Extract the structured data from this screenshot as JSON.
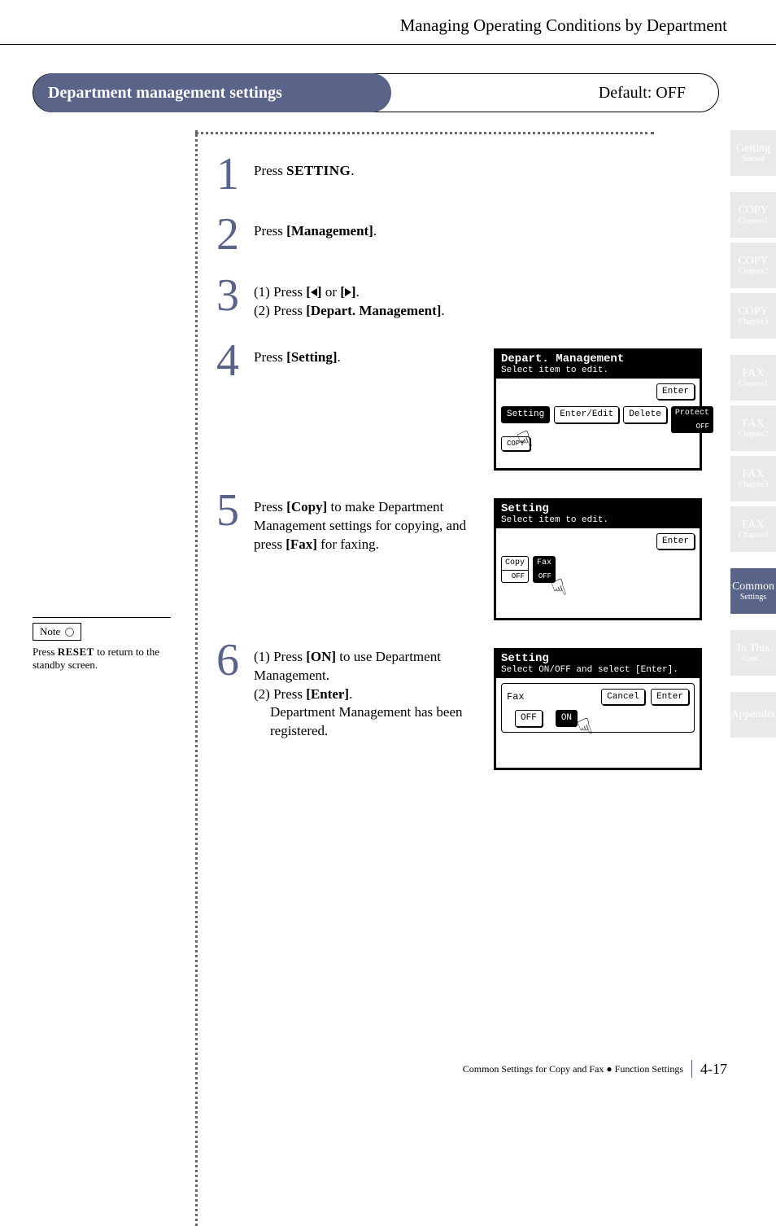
{
  "header": {
    "title": "Managing Operating Conditions by Department"
  },
  "section": {
    "title": "Department management settings",
    "default": "Default: OFF"
  },
  "steps": {
    "s1": {
      "pre": "Press ",
      "kw": "SETTING",
      "post": "."
    },
    "s2": {
      "pre": "Press ",
      "kw": "[Management]",
      "post": "."
    },
    "s3a": {
      "pre": "(1) Press ",
      "kw1": "[",
      "kw2": "]",
      "mid": " or ",
      "kw3": "[",
      "kw4": "]",
      "post": "."
    },
    "s3b": {
      "pre": "(2) Press ",
      "kw": "[Depart. Management]",
      "post": "."
    },
    "s4": {
      "pre": "Press ",
      "kw": "[Setting]",
      "post": "."
    },
    "s5": {
      "pre": "Press ",
      "kw1": "[Copy]",
      "mid1": " to make Department Management settings for copying, and press ",
      "kw2": "[Fax]",
      "mid2": " for faxing."
    },
    "s6a": {
      "pre": "(1) Press ",
      "kw": "[ON]",
      "post": " to use Department Management."
    },
    "s6b": {
      "pre": "(2) Press ",
      "kw": "[Enter]",
      "post": "."
    },
    "s6c": "Department Management has been registered."
  },
  "lcd1": {
    "title": "Depart. Management",
    "sub": "Select item to edit.",
    "enter": "Enter",
    "b1": "Setting",
    "b2": "Enter/Edit",
    "b3": "Delete",
    "b4t": "Protect",
    "b4b": "OFF",
    "b5": "COPY"
  },
  "lcd2": {
    "title": "Setting",
    "sub": "Select item to edit.",
    "enter": "Enter",
    "c1t": "Copy",
    "c1b": "OFF",
    "c2t": "Fax",
    "c2b": "OFF"
  },
  "lcd3": {
    "title": "Setting",
    "sub": "Select ON/OFF and select [Enter].",
    "fax": "Fax",
    "cancel": "Cancel",
    "enter": "Enter",
    "off": "OFF",
    "on": "ON"
  },
  "note": {
    "label": "Note",
    "body_pre": "Press ",
    "body_kw": "RESET",
    "body_post": " to return to the standby screen."
  },
  "tabs": [
    {
      "l1": "Getting",
      "l2": "Started"
    },
    {
      "l1": "COPY",
      "l2": "Chapter1"
    },
    {
      "l1": "COPY",
      "l2": "Chapter2"
    },
    {
      "l1": "COPY",
      "l2": "Chapter3"
    },
    {
      "l1": "FAX",
      "l2": "Chapter1"
    },
    {
      "l1": "FAX",
      "l2": "Chapter2"
    },
    {
      "l1": "FAX",
      "l2": "Chapter3"
    },
    {
      "l1": "FAX",
      "l2": "Chapter4"
    },
    {
      "l1": "Common",
      "l2": "Settings"
    },
    {
      "l1": "In This",
      "l2": "Case..."
    },
    {
      "l1": "Appendix",
      "l2": ""
    }
  ],
  "footer": {
    "text": "Common Settings for Copy and Fax ● Function Settings",
    "page": "4-17"
  }
}
